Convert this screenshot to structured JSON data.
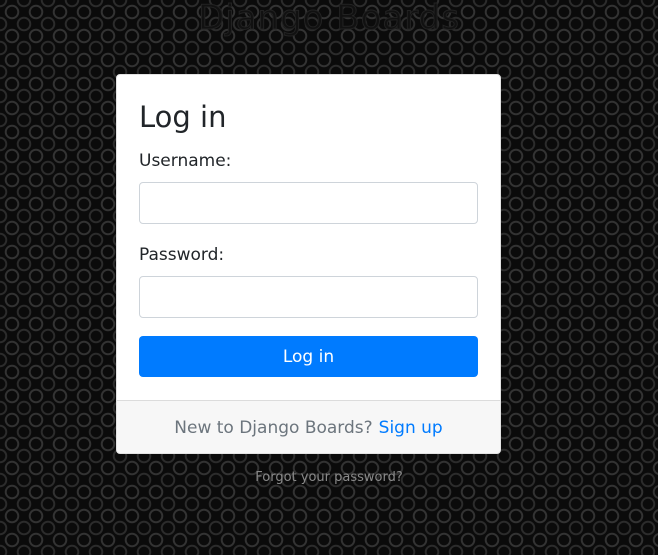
{
  "brand": {
    "logo_text": "Django Boards"
  },
  "login": {
    "title": "Log in",
    "username_label": "Username:",
    "username_value": "",
    "password_label": "Password:",
    "password_value": "",
    "submit_label": "Log in"
  },
  "footer": {
    "prompt": "New to Django Boards?",
    "signup_label": "Sign up"
  },
  "links": {
    "forgot_password": "Forgot your password?"
  },
  "colors": {
    "primary": "#007bff",
    "background": "#0b0b0b"
  }
}
